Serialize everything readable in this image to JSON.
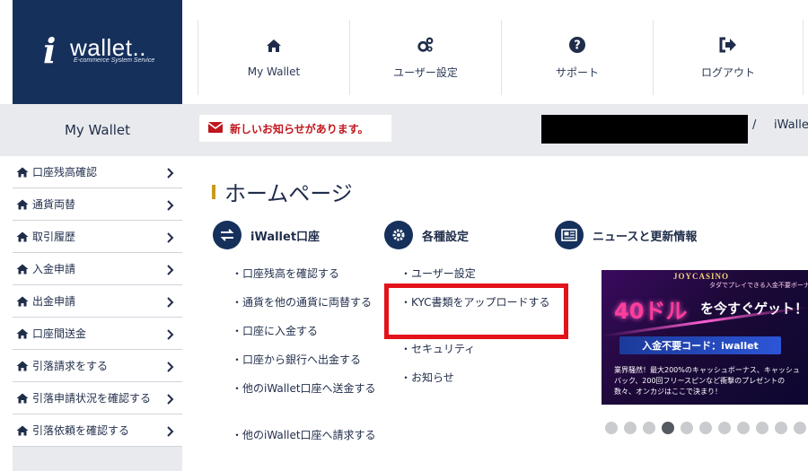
{
  "brand": {
    "logo_i": "i",
    "logo_word": "wallet..",
    "logo_sub": "E-commerce System Service"
  },
  "nav": [
    {
      "label": "My Wallet",
      "icon": "home-icon"
    },
    {
      "label": "ユーザー設定",
      "icon": "gears-icon"
    },
    {
      "label": "サポート",
      "icon": "question-icon"
    },
    {
      "label": "ログアウト",
      "icon": "logout-icon"
    }
  ],
  "sidebar": {
    "title": "My Wallet",
    "items": [
      {
        "label": "口座残高確認"
      },
      {
        "label": "通貨両替"
      },
      {
        "label": "取引履歴"
      },
      {
        "label": "入金申請"
      },
      {
        "label": "出金申請"
      },
      {
        "label": "口座間送金"
      },
      {
        "label": "引落請求をする"
      },
      {
        "label": "引落申請状況を確認する"
      },
      {
        "label": "引落依頼を確認する"
      }
    ]
  },
  "notice": {
    "text": "新しいお知らせがあります。",
    "icon": "envelope-icon"
  },
  "breadcrumb": {
    "separator": "/",
    "current": "iWallet"
  },
  "page_title": "ホームページ",
  "sections": {
    "account": {
      "title": "iWallet口座",
      "icon": "exchange-icon",
      "links": [
        "・口座残高を確認する",
        "・通貨を他の通貨に両替する",
        "・口座に入金する",
        "・口座から銀行へ出金する",
        "・他のiWallet口座へ送金する",
        "・他のiWallet口座へ請求する"
      ]
    },
    "settings": {
      "title": "各種設定",
      "icon": "gear-icon",
      "links": [
        "・ユーザー設定",
        "・KYC書類をアップロードする",
        "・セキュリティ",
        "・お知らせ"
      ]
    },
    "news": {
      "title": "ニュースと更新情報",
      "icon": "newspaper-icon"
    }
  },
  "banner": {
    "logo": "JOYCASINO",
    "top_text": "タダでプレイできる入金不要ボーナスで",
    "main_big": "40ドル",
    "main_rest": "を今すぐゲット！",
    "code": "入金不要コード：iwallet",
    "desc": "業界騒然！最大200%のキャッシュボーナス、キャッシュバック、200回フリースピンなど衝撃のプレゼントの数々、オンカジはここで決まり！"
  },
  "carousel": {
    "count": 11,
    "active_index": 3
  },
  "colors": {
    "navy": "#16305c",
    "notice_red": "#c0171d",
    "highlight_red": "#e3131b",
    "title_accent": "#c99a1c",
    "panel_gray": "#e8eaed"
  }
}
